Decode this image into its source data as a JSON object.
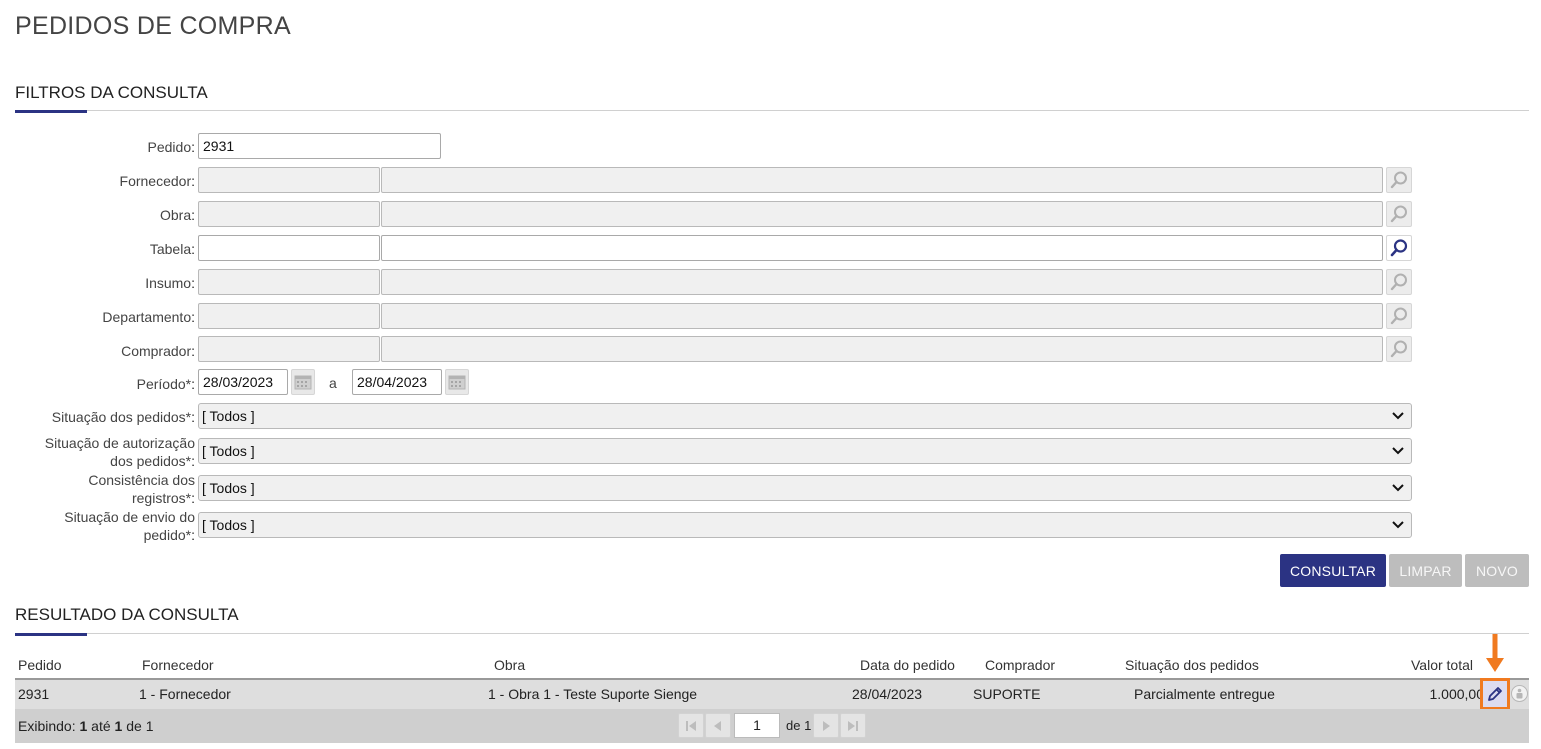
{
  "page": {
    "title": "PEDIDOS DE COMPRA"
  },
  "filters": {
    "section_title": "FILTROS DA CONSULTA",
    "pedido": {
      "label": "Pedido",
      "value": "2931"
    },
    "fornecedor": {
      "label": "Fornecedor",
      "code": "",
      "name": ""
    },
    "obra": {
      "label": "Obra",
      "code": "",
      "name": ""
    },
    "tabela": {
      "label": "Tabela",
      "code": "",
      "name": ""
    },
    "insumo": {
      "label": "Insumo",
      "code": "",
      "name": ""
    },
    "departamento": {
      "label": "Departamento",
      "code": "",
      "name": ""
    },
    "comprador": {
      "label": "Comprador",
      "code": "",
      "name": ""
    },
    "periodo": {
      "label": "Período*",
      "start": "28/03/2023",
      "separator": "a",
      "end": "28/04/2023"
    },
    "situacao_pedidos": {
      "label": "Situação dos pedidos*",
      "value": "[ Todos ]"
    },
    "situacao_autorizacao": {
      "label_line1": "Situação de autorização",
      "label_line2": "dos pedidos*",
      "value": "[ Todos ]"
    },
    "consistencia": {
      "label_line1": "Consistência dos",
      "label_line2": "registros*",
      "value": "[ Todos ]"
    },
    "situacao_envio": {
      "label_line1": "Situação de envio do",
      "label_line2": "pedido*",
      "value": "[ Todos ]"
    }
  },
  "actions": {
    "consultar": "CONSULTAR",
    "limpar": "LIMPAR",
    "novo": "NOVO"
  },
  "results": {
    "section_title": "RESULTADO DA CONSULTA",
    "columns": [
      "Pedido",
      "Fornecedor",
      "Obra",
      "Data do pedido",
      "Comprador",
      "Situação dos pedidos",
      "Valor total"
    ],
    "rows": [
      {
        "pedido": "2931",
        "fornecedor": "1 - Fornecedor",
        "obra": "1 - Obra 1 - Teste Suporte Sienge",
        "data": "28/04/2023",
        "comprador": "SUPORTE",
        "situacao": "Parcialmente entregue",
        "valor": "1.000,00"
      }
    ],
    "footer": {
      "exibindo_prefix": "Exibindo:",
      "from": "1",
      "ate": "até",
      "to": "1",
      "de": "de",
      "total": "1",
      "page": "1",
      "of_label": "de 1"
    }
  },
  "icons": {
    "lookup": "magnifier-icon",
    "calendar": "calendar-icon",
    "edit": "pencil-icon",
    "info": "info-icon",
    "annotation": "orange-arrow-down"
  },
  "colors": {
    "primary": "#2b3383",
    "highlight": "#f07a20",
    "disabled": "#bdbdbd"
  }
}
